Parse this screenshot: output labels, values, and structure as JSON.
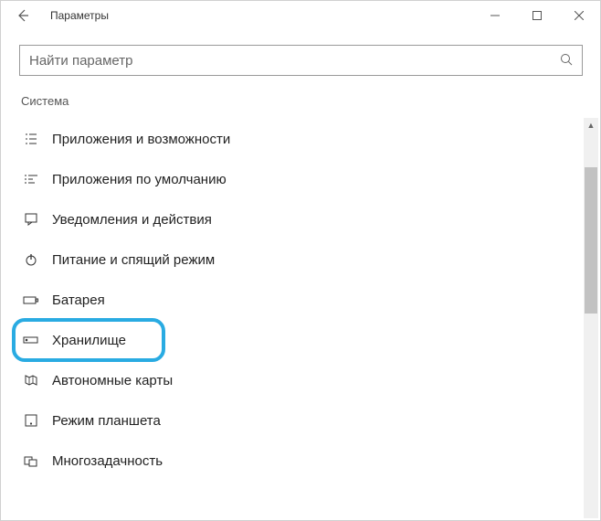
{
  "window": {
    "title": "Параметры"
  },
  "search": {
    "placeholder": "Найти параметр"
  },
  "category": "Система",
  "nav": {
    "items": [
      {
        "id": "apps-features",
        "label": "Приложения и возможности",
        "icon": "apps-features-icon"
      },
      {
        "id": "default-apps",
        "label": "Приложения по умолчанию",
        "icon": "default-apps-icon"
      },
      {
        "id": "notifications",
        "label": "Уведомления и действия",
        "icon": "notifications-icon"
      },
      {
        "id": "power-sleep",
        "label": "Питание и спящий режим",
        "icon": "power-icon"
      },
      {
        "id": "battery",
        "label": "Батарея",
        "icon": "battery-icon"
      },
      {
        "id": "storage",
        "label": "Хранилище",
        "icon": "storage-icon",
        "highlighted": true
      },
      {
        "id": "offline-maps",
        "label": "Автономные карты",
        "icon": "maps-icon"
      },
      {
        "id": "tablet-mode",
        "label": "Режим планшета",
        "icon": "tablet-icon"
      },
      {
        "id": "multitasking",
        "label": "Многозадачность",
        "icon": "multitasking-icon"
      }
    ]
  }
}
